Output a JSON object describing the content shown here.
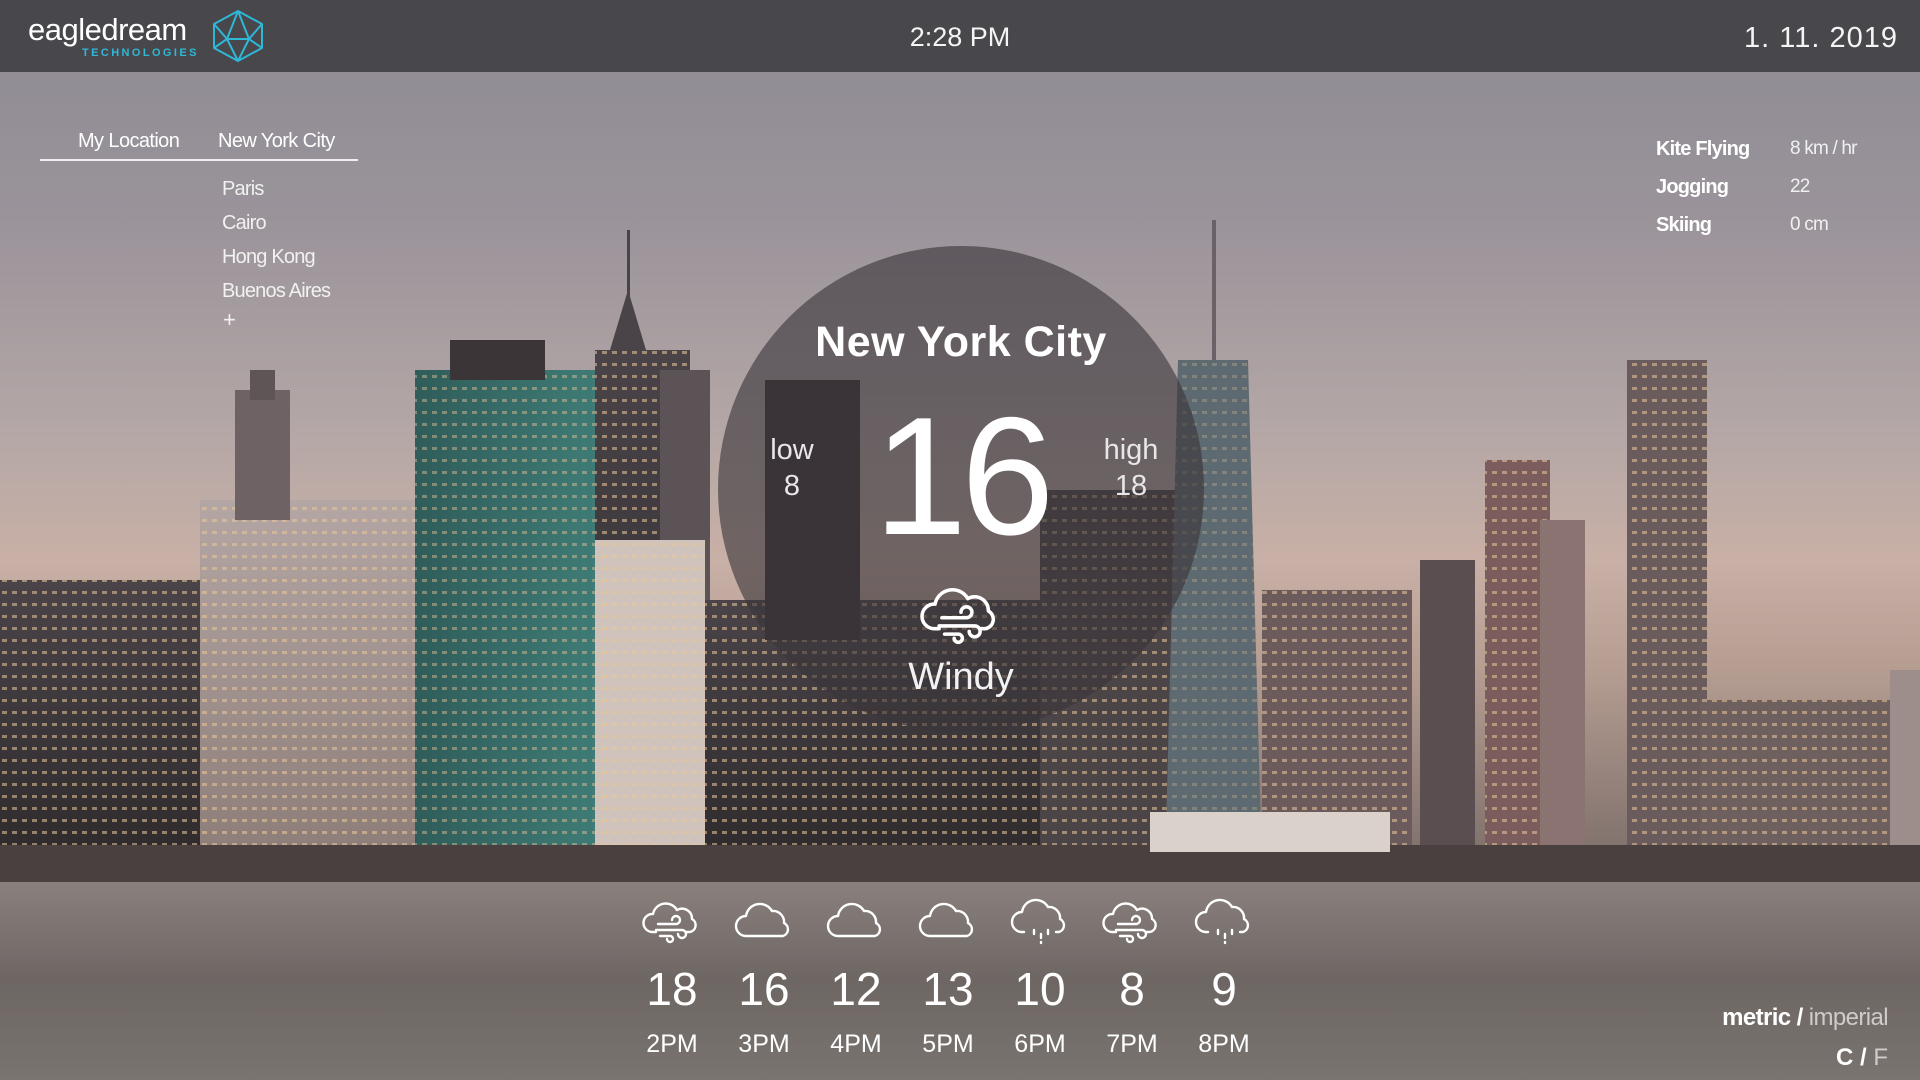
{
  "header": {
    "logo_name": "eagledream",
    "logo_sub": "TECHNOLOGIES",
    "time": "2:28 PM",
    "date": "1. 11. 2019"
  },
  "locations": {
    "tabs": [
      "My Location",
      "New York City"
    ],
    "cities": [
      "Paris",
      "Cairo",
      "Hong Kong",
      "Buenos Aires"
    ],
    "add_label": "+"
  },
  "activities": [
    {
      "name": "Kite Flying",
      "value": "8 km / hr"
    },
    {
      "name": "Jogging",
      "value": "22"
    },
    {
      "name": "Skiing",
      "value": "0 cm"
    }
  ],
  "current": {
    "city": "New York City",
    "temp": "16",
    "low_label": "low",
    "low_value": "8",
    "high_label": "high",
    "high_value": "18",
    "condition": "Windy",
    "icon": "windy-cloud-icon"
  },
  "hourly": [
    {
      "temp": "18",
      "time": "2PM",
      "icon": "windy-cloud-icon"
    },
    {
      "temp": "16",
      "time": "3PM",
      "icon": "cloud-icon"
    },
    {
      "temp": "12",
      "time": "4PM",
      "icon": "cloud-icon"
    },
    {
      "temp": "13",
      "time": "5PM",
      "icon": "cloud-icon"
    },
    {
      "temp": "10",
      "time": "6PM",
      "icon": "drizzle-cloud-icon"
    },
    {
      "temp": "8",
      "time": "7PM",
      "icon": "windy-cloud-icon"
    },
    {
      "temp": "9",
      "time": "8PM",
      "icon": "drizzle-cloud-icon"
    }
  ],
  "units": {
    "metric": "metric",
    "separator": "/",
    "imperial": "imperial",
    "celsius": "C",
    "fahrenheit": "F"
  },
  "colors": {
    "accent": "#2fb7d6",
    "topbar": "#3e3e42",
    "text": "#ffffff"
  }
}
